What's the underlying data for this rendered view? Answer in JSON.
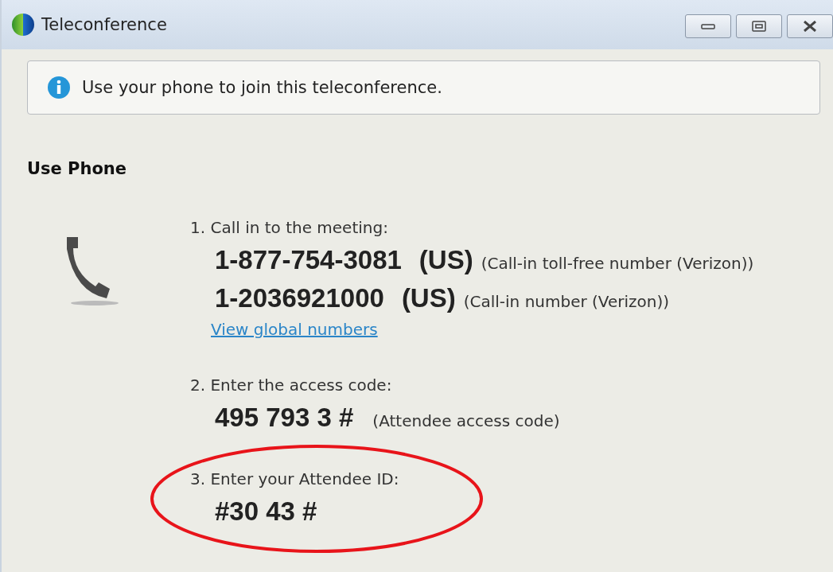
{
  "window": {
    "title": "Teleconference"
  },
  "info": {
    "message": "Use your phone to join this teleconference."
  },
  "section": {
    "title": "Use Phone"
  },
  "steps": [
    {
      "kind": "numbers",
      "label": "1. Call in to the meeting:",
      "highlighted": false,
      "numbers": [
        {
          "number": "1-877-754-3081",
          "region": "(US)",
          "note": "(Call-in toll-free number (Verizon))"
        },
        {
          "number": "1-2036921000",
          "region": "(US)",
          "note": "(Call-in number (Verizon))"
        }
      ],
      "link": "View global numbers"
    },
    {
      "kind": "code",
      "label": "2. Enter the access code:",
      "highlighted": false,
      "code": "495 793 3 #",
      "note": "(Attendee access code)"
    },
    {
      "kind": "code",
      "label": "3. Enter your Attendee ID:",
      "highlighted": true,
      "code": "#30 43 #"
    }
  ]
}
